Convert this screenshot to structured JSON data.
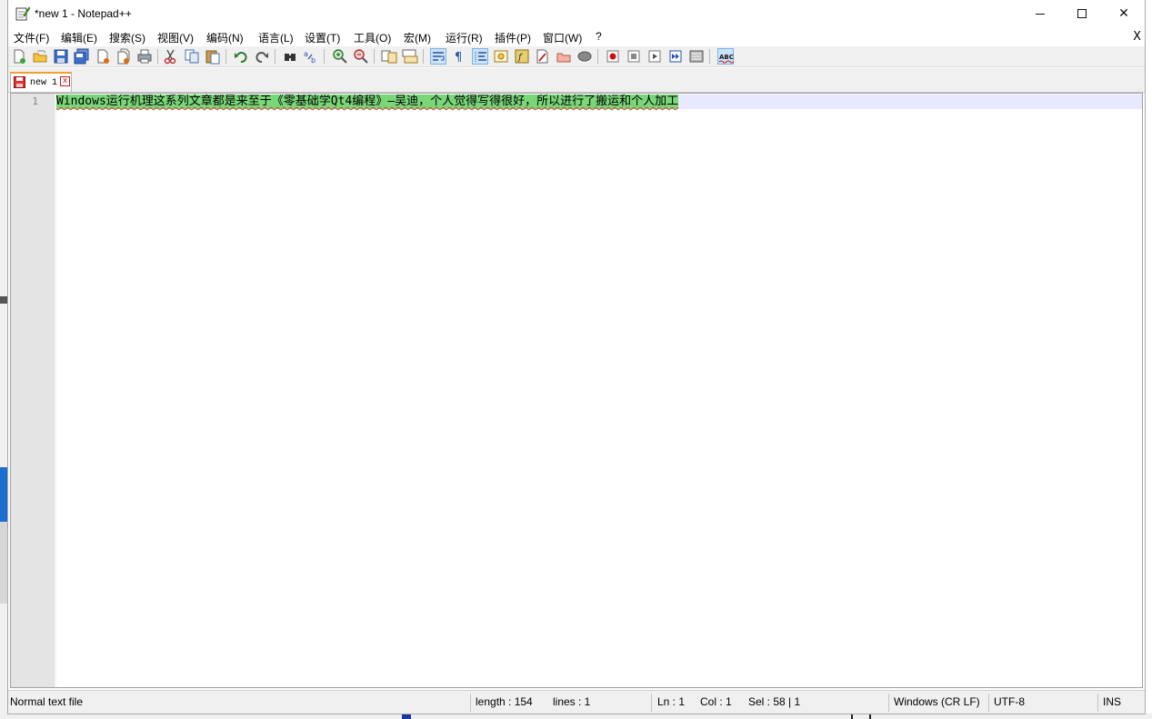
{
  "window": {
    "title": "*new 1 - Notepad++",
    "min_label": "",
    "max_label": "",
    "close_label": "✕"
  },
  "menu": {
    "items": [
      "文件(F)",
      "编辑(E)",
      "搜索(S)",
      "视图(V)",
      "编码(N)",
      "语言(L)",
      "设置(T)",
      "工具(O)",
      "宏(M)",
      "运行(R)",
      "插件(P)",
      "窗口(W)",
      "?"
    ],
    "close_doc": "X"
  },
  "toolbar": {
    "icons": [
      "new-file-icon",
      "open-file-icon",
      "save-icon",
      "save-all-icon",
      "close-icon",
      "close-all-icon",
      "print-icon",
      "cut-icon",
      "copy-icon",
      "paste-icon",
      "undo-icon",
      "redo-icon",
      "find-icon",
      "replace-icon",
      "zoom-in-icon",
      "zoom-out-icon",
      "sync-vertical-icon",
      "sync-horizontal-icon",
      "word-wrap-icon",
      "show-all-chars-icon",
      "indent-guide-icon",
      "doc-map-icon",
      "function-list-icon",
      "folder-workspace-icon",
      "doc-switcher-icon",
      "monitoring-icon",
      "record-macro-icon",
      "stop-record-icon",
      "play-macro-icon",
      "run-macro-multiple-icon",
      "save-macro-icon",
      "spell-check-icon"
    ],
    "spell_check_text": "ABC"
  },
  "tabs": [
    {
      "label": "new 1",
      "close": "x",
      "active": true,
      "modified": true
    }
  ],
  "editor": {
    "lines": [
      {
        "number": "1",
        "text": "Windows运行机理这系列文章都是来至于《零基础学Qt4编程》—吴迪，个人觉得写得很好，所以进行了搬运和个人加工"
      }
    ],
    "selection_color": "#79d779",
    "current_line_color": "#e8e8ff"
  },
  "status": {
    "file_type": "Normal text file",
    "length": "length : 154",
    "lines": "lines : 1",
    "ln": "Ln : 1",
    "col": "Col : 1",
    "sel": "Sel : 58 | 1",
    "eol": "Windows (CR LF)",
    "encoding": "UTF-8",
    "mode": "INS"
  }
}
